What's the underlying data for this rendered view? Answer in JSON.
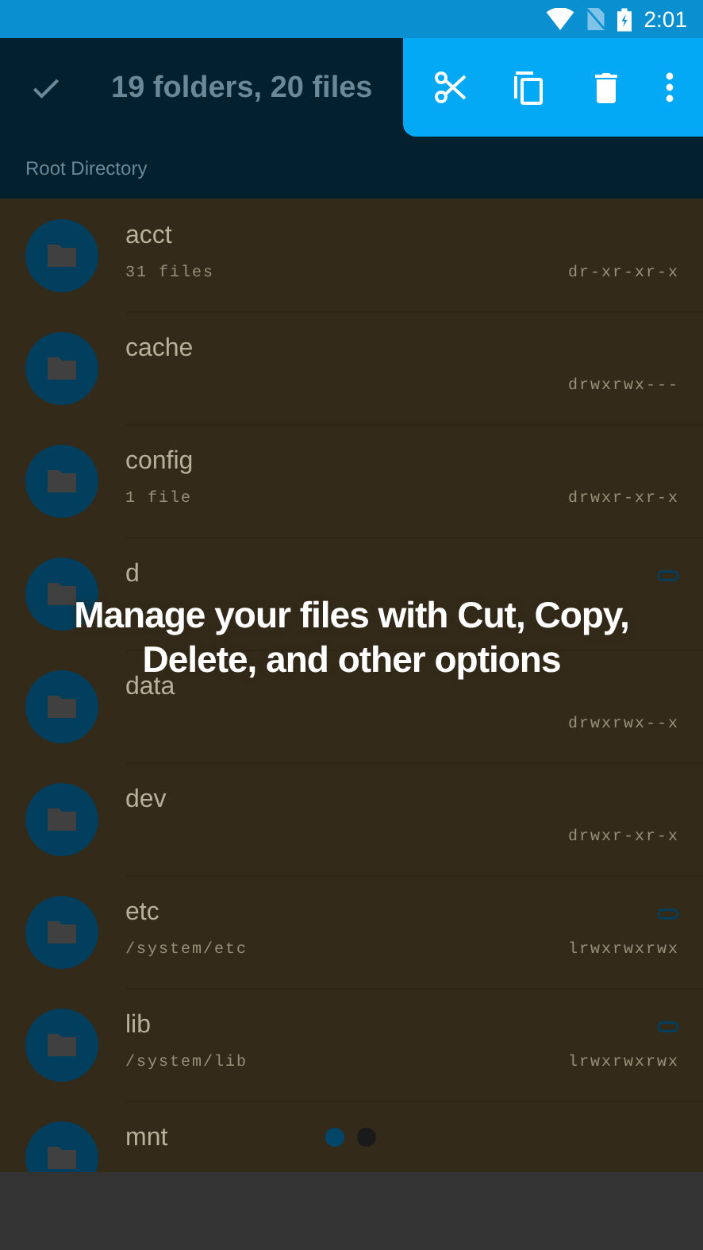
{
  "status_bar": {
    "time": "2:01"
  },
  "toolbar": {
    "title": "19 folders, 20 files"
  },
  "action_menu": {
    "actions": [
      {
        "kind": "cut"
      },
      {
        "kind": "copy"
      },
      {
        "kind": "delete"
      },
      {
        "kind": "more"
      }
    ]
  },
  "breadcrumb": "Root Directory",
  "files": [
    {
      "name": "acct",
      "info": "31 files",
      "permissions": "dr-xr-xr-x",
      "link": false
    },
    {
      "name": "cache",
      "permissions": "drwxrwx---",
      "link": false
    },
    {
      "name": "config",
      "info": "1 file",
      "permissions": "drwxr-xr-x",
      "link": false
    },
    {
      "name": "d",
      "link": true
    },
    {
      "name": "data",
      "permissions": "drwxrwx--x",
      "link": false
    },
    {
      "name": "dev",
      "permissions": "drwxr-xr-x",
      "link": false
    },
    {
      "name": "etc",
      "info": "/system/etc",
      "permissions": "lrwxrwxrwx",
      "link": true
    },
    {
      "name": "lib",
      "info": "/system/lib",
      "permissions": "lrwxrwxrwx",
      "link": true
    },
    {
      "name": "mnt",
      "link": false
    }
  ],
  "tutorial": {
    "message": "Manage your files with Cut, Copy, Delete, and other options",
    "pager_dots": [
      {
        "selected": true
      },
      {
        "selected": false
      }
    ]
  }
}
